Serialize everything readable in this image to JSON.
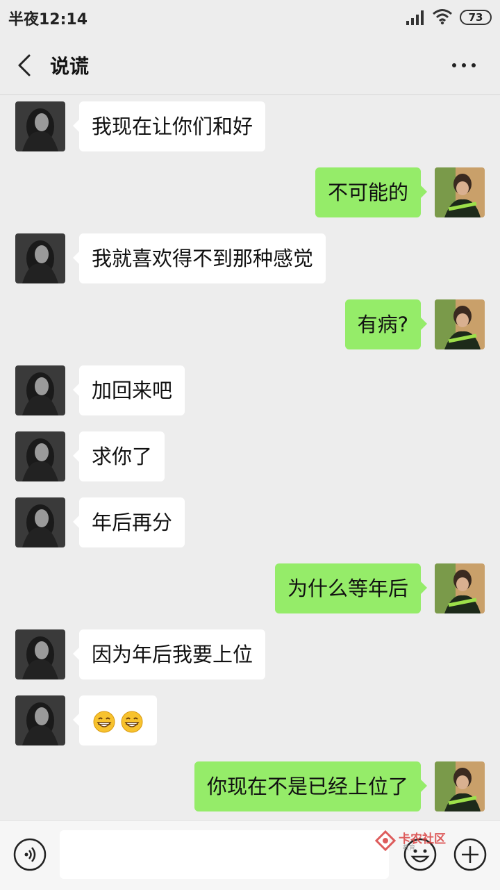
{
  "status_bar": {
    "time": "半夜12:14",
    "battery": "73"
  },
  "header": {
    "title": "说谎"
  },
  "messages": [
    {
      "side": "in",
      "text": "我现在让你们和好"
    },
    {
      "side": "out",
      "text": "不可能的"
    },
    {
      "side": "in",
      "text": "我就喜欢得不到那种感觉"
    },
    {
      "side": "out",
      "text": "有病?"
    },
    {
      "side": "in",
      "text": "加回来吧"
    },
    {
      "side": "in",
      "text": "求你了"
    },
    {
      "side": "in",
      "text": "年后再分"
    },
    {
      "side": "out",
      "text": "为什么等年后"
    },
    {
      "side": "in",
      "text": "因为年后我要上位"
    },
    {
      "side": "in",
      "text": "",
      "emoji": [
        "grin-emoji",
        "grin-emoji"
      ]
    },
    {
      "side": "out",
      "text": "你现在不是已经上位了"
    }
  ],
  "input": {
    "value": "",
    "placeholder": ""
  },
  "watermark": {
    "text": "卡农社区",
    "sub": "教育"
  },
  "icons": {
    "back": "chevron-left-icon",
    "more": "more-dots-icon",
    "voice": "voice-icon",
    "emoji": "emoji-icon",
    "plus": "plus-icon"
  },
  "colors": {
    "background": "#ededed",
    "bubble_in": "#ffffff",
    "bubble_out": "#95ec69"
  }
}
